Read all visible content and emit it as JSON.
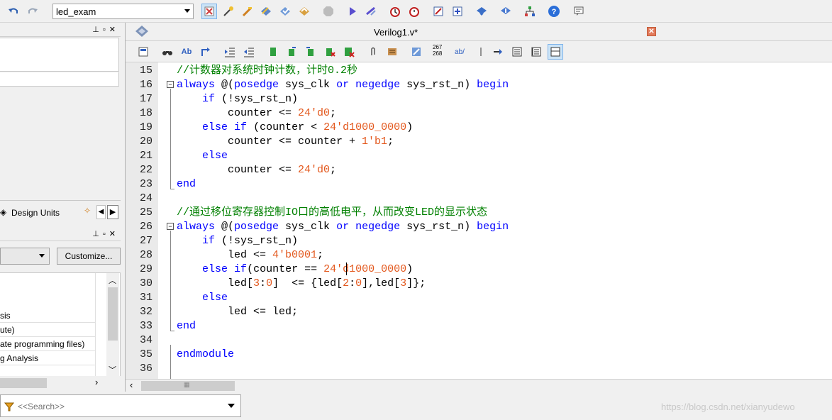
{
  "toolbar": {
    "project": "led_exam"
  },
  "left_panel": {
    "tab_design_units": "Design Units",
    "customize_label": "Customize...",
    "tasks": [
      "sis",
      "ute)",
      "ate programming files)",
      "g Analysis"
    ]
  },
  "editor": {
    "title": "Verilog1.v*",
    "toolbar_badges": {
      "linenum": "267 268",
      "ab": "ab/"
    },
    "lines": [
      {
        "n": "15",
        "segs": [
          {
            "t": "//计数器对系统时钟计数，计时0.2秒",
            "c": "cm"
          }
        ]
      },
      {
        "n": "16",
        "segs": [
          {
            "t": "always",
            "c": "kw"
          },
          {
            "t": " @("
          },
          {
            "t": "posedge",
            "c": "kw"
          },
          {
            "t": " sys_clk "
          },
          {
            "t": "or",
            "c": "kw"
          },
          {
            "t": " "
          },
          {
            "t": "negedge",
            "c": "kw"
          },
          {
            "t": " sys_rst_n) "
          },
          {
            "t": "begin",
            "c": "kw"
          }
        ]
      },
      {
        "n": "17",
        "segs": [
          {
            "t": "    "
          },
          {
            "t": "if",
            "c": "kw"
          },
          {
            "t": " (!sys_rst_n)"
          }
        ]
      },
      {
        "n": "18",
        "segs": [
          {
            "t": "        counter <= "
          },
          {
            "t": "24'd0",
            "c": "nm"
          },
          {
            "t": ";"
          }
        ]
      },
      {
        "n": "19",
        "segs": [
          {
            "t": "    "
          },
          {
            "t": "else",
            "c": "kw"
          },
          {
            "t": " "
          },
          {
            "t": "if",
            "c": "kw"
          },
          {
            "t": " (counter < "
          },
          {
            "t": "24'd1000_0000",
            "c": "nm"
          },
          {
            "t": ")"
          }
        ]
      },
      {
        "n": "20",
        "segs": [
          {
            "t": "        counter <= counter + "
          },
          {
            "t": "1'b1",
            "c": "nm"
          },
          {
            "t": ";"
          }
        ]
      },
      {
        "n": "21",
        "segs": [
          {
            "t": "    "
          },
          {
            "t": "else",
            "c": "kw"
          }
        ]
      },
      {
        "n": "22",
        "segs": [
          {
            "t": "        counter <= "
          },
          {
            "t": "24'd0",
            "c": "nm"
          },
          {
            "t": ";"
          }
        ]
      },
      {
        "n": "23",
        "segs": [
          {
            "t": "end",
            "c": "kw"
          }
        ]
      },
      {
        "n": "24",
        "segs": []
      },
      {
        "n": "25",
        "segs": [
          {
            "t": "//通过移位寄存器控制IO口的高低电平，从而改变LED的显示状态",
            "c": "cm"
          }
        ]
      },
      {
        "n": "26",
        "segs": [
          {
            "t": "always",
            "c": "kw"
          },
          {
            "t": " @("
          },
          {
            "t": "posedge",
            "c": "kw"
          },
          {
            "t": " sys_clk "
          },
          {
            "t": "or",
            "c": "kw"
          },
          {
            "t": " "
          },
          {
            "t": "negedge",
            "c": "kw"
          },
          {
            "t": " sys_rst_n) "
          },
          {
            "t": "begin",
            "c": "kw"
          }
        ]
      },
      {
        "n": "27",
        "segs": [
          {
            "t": "    "
          },
          {
            "t": "if",
            "c": "kw"
          },
          {
            "t": " (!sys_rst_n)"
          }
        ]
      },
      {
        "n": "28",
        "segs": [
          {
            "t": "        led <= "
          },
          {
            "t": "4'b0001",
            "c": "nm"
          },
          {
            "t": ";"
          }
        ]
      },
      {
        "n": "29",
        "segs": [
          {
            "t": "    "
          },
          {
            "t": "else",
            "c": "kw"
          },
          {
            "t": " "
          },
          {
            "t": "if",
            "c": "kw"
          },
          {
            "t": "(counter == "
          },
          {
            "t": "24'd1000_0000",
            "c": "nm"
          },
          {
            "t": ")"
          }
        ]
      },
      {
        "n": "30",
        "segs": [
          {
            "t": "        led["
          },
          {
            "t": "3",
            "c": "nm"
          },
          {
            "t": ":"
          },
          {
            "t": "0",
            "c": "nm"
          },
          {
            "t": "]  <= {led["
          },
          {
            "t": "2",
            "c": "nm"
          },
          {
            "t": ":"
          },
          {
            "t": "0",
            "c": "nm"
          },
          {
            "t": "],led["
          },
          {
            "t": "3",
            "c": "nm"
          },
          {
            "t": "]};"
          }
        ]
      },
      {
        "n": "31",
        "segs": [
          {
            "t": "    "
          },
          {
            "t": "else",
            "c": "kw"
          }
        ]
      },
      {
        "n": "32",
        "segs": [
          {
            "t": "        led <= led;"
          }
        ]
      },
      {
        "n": "33",
        "segs": [
          {
            "t": "end",
            "c": "kw"
          }
        ]
      },
      {
        "n": "34",
        "segs": []
      },
      {
        "n": "35",
        "segs": [
          {
            "t": "endmodule",
            "c": "kw"
          }
        ]
      },
      {
        "n": "36",
        "segs": []
      }
    ]
  },
  "search": {
    "placeholder": "<<Search>>"
  },
  "watermark": "https://blog.csdn.net/xianyudewo"
}
